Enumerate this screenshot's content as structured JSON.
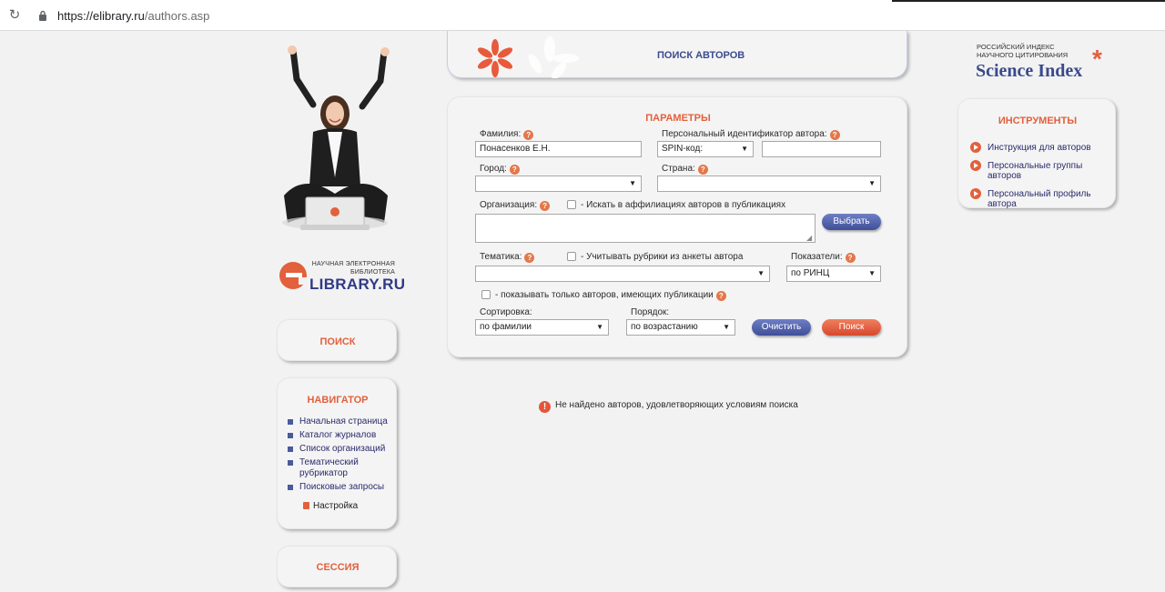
{
  "browser": {
    "url_host": "https://elibrary.ru",
    "url_path": "/authors.asp"
  },
  "logo": {
    "subtitle_line1": "НАУЧНАЯ ЭЛЕКТРОННАЯ",
    "subtitle_line2": "БИБЛИОТЕКА",
    "brand": "LIBRARY.RU"
  },
  "left": {
    "search_title": "ПОИСК",
    "navigator_title": "НАВИГАТОР",
    "nav_items": [
      "Начальная страница",
      "Каталог журналов",
      "Список организаций",
      "Тематический рубрикатор",
      "Поисковые запросы"
    ],
    "settings_label": "Настройка",
    "session_title": "СЕССИЯ"
  },
  "header": {
    "title": "ПОИСК АВТОРОВ"
  },
  "params": {
    "title": "ПАРАМЕТРЫ",
    "surname_label": "Фамилия:",
    "surname_value": "Понасенков Е.Н.",
    "author_id_label": "Персональный идентификатор автора:",
    "id_type_value": "SPIN-код:",
    "id_value": "",
    "city_label": "Город:",
    "city_value": "",
    "country_label": "Страна:",
    "country_value": "",
    "org_label": "Организация:",
    "affil_checkbox_label": "- Искать в аффилиациях авторов в публикациях",
    "org_value": "",
    "choose_button": "Выбрать",
    "topic_label": "Тематика:",
    "rubric_checkbox_label": "- Учитывать рубрики из анкеты автора",
    "topic_value": "",
    "indicators_label": "Показатели:",
    "indicators_value": "по РИНЦ",
    "only_pub_label": "- показывать только авторов, имеющих публикации",
    "sort_label": "Сортировка:",
    "sort_value": "по фамилии",
    "order_label": "Порядок:",
    "order_value": "по возрастанию",
    "clear_button": "Очистить",
    "search_button": "Поиск"
  },
  "notice": {
    "text": "Не найдено авторов, удовлетворяющих условиям поиска"
  },
  "science_index": {
    "line1": "РОССИЙСКИЙ ИНДЕКС",
    "line2": "НАУЧНОГО ЦИТИРОВАНИЯ",
    "brand": "Science Index"
  },
  "tools": {
    "title": "ИНСТРУМЕНТЫ",
    "items": [
      "Инструкция для авторов",
      "Персональные группы авторов",
      "Персональный профиль автора"
    ]
  },
  "colors": {
    "accent": "#e2603c",
    "navy": "#3a4a8c",
    "button_blue": "#4a5ba6",
    "button_red": "#e05a3a"
  }
}
